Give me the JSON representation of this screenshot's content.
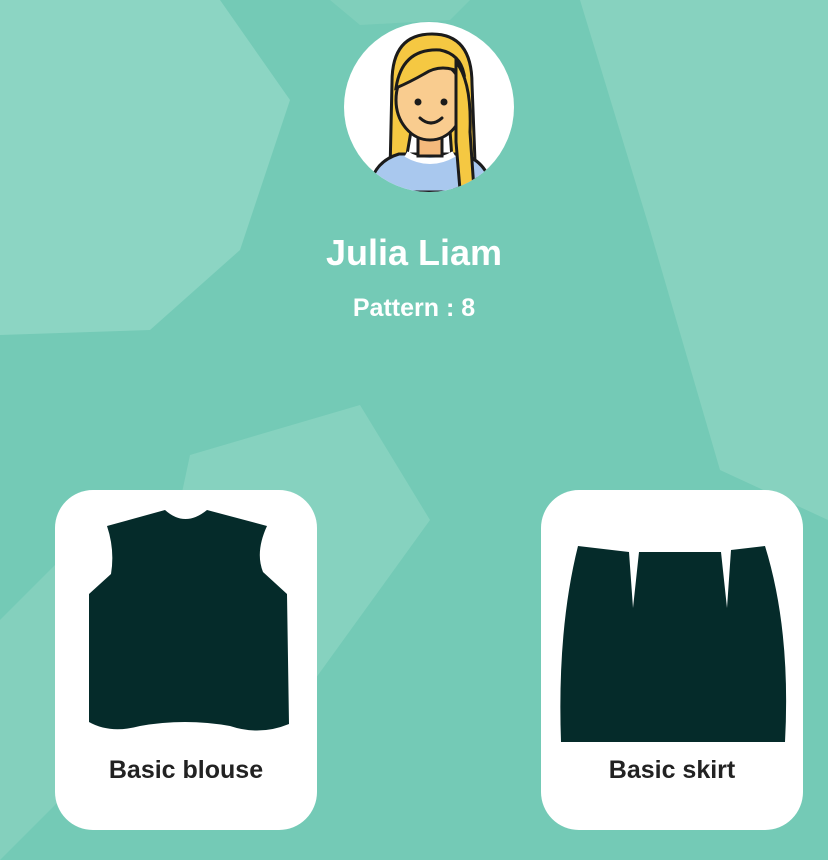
{
  "profile": {
    "name": "Julia Liam",
    "pattern_label": "Pattern : 8",
    "avatar_icon": "woman-avatar-icon"
  },
  "cards": [
    {
      "label": "Basic blouse",
      "icon": "blouse-pattern-icon"
    },
    {
      "label": "Basic skirt",
      "icon": "skirt-pattern-icon"
    }
  ],
  "colors": {
    "background": "#74cab6",
    "background_shape": "#8cd5c3",
    "garment": "#052b2a",
    "card": "#ffffff",
    "text_light": "#ffffff",
    "text_dark": "#222222"
  }
}
